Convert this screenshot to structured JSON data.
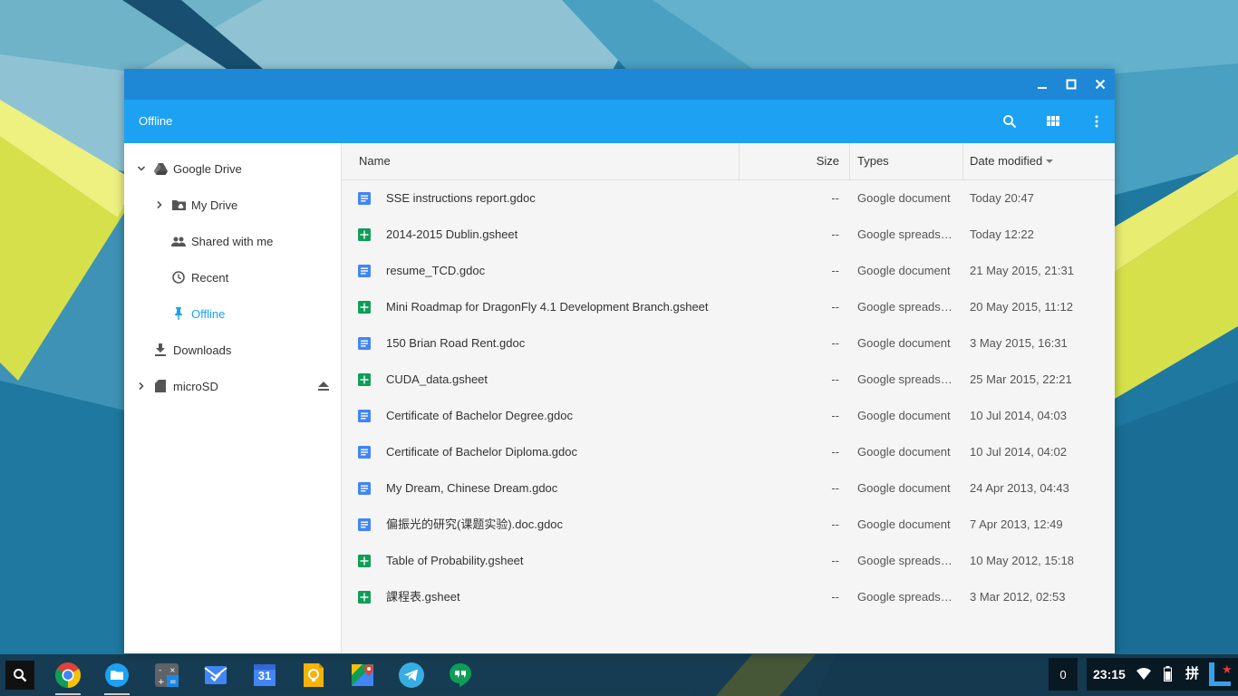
{
  "window": {
    "title": "Offline",
    "controls": {
      "minimize": "minimize-icon",
      "maximize": "maximize-icon",
      "close": "close-icon"
    },
    "toolbar_icons": [
      "search-icon",
      "grid-view-icon",
      "more-vert-icon"
    ]
  },
  "sidebar": {
    "items": [
      {
        "label": "Google Drive",
        "icon": "google-drive-icon",
        "expanded": true
      },
      {
        "label": "My Drive",
        "icon": "folder-drive-icon",
        "expanded": false
      },
      {
        "label": "Shared with me",
        "icon": "people-icon"
      },
      {
        "label": "Recent",
        "icon": "clock-icon"
      },
      {
        "label": "Offline",
        "icon": "pin-icon",
        "active": true
      },
      {
        "label": "Downloads",
        "icon": "download-icon"
      },
      {
        "label": "microSD",
        "icon": "sd-card-icon",
        "expanded": false,
        "eject": "eject-icon"
      }
    ]
  },
  "table": {
    "columns": {
      "name": "Name",
      "size": "Size",
      "type": "Types",
      "date": "Date modified"
    },
    "sort": {
      "column": "date",
      "direction": "descending"
    },
    "rows": [
      {
        "name": "SSE instructions report.gdoc",
        "size": "--",
        "type": "Google document",
        "date": "Today 20:47",
        "kind": "doc"
      },
      {
        "name": "2014-2015 Dublin.gsheet",
        "size": "--",
        "type": "Google spreadsheet",
        "date": "Today 12:22",
        "kind": "sheet"
      },
      {
        "name": "resume_TCD.gdoc",
        "size": "--",
        "type": "Google document",
        "date": "21 May 2015, 21:31",
        "kind": "doc"
      },
      {
        "name": "Mini Roadmap for DragonFly 4.1 Development Branch.gsheet",
        "size": "--",
        "type": "Google spreadsheet",
        "date": "20 May 2015, 11:12",
        "kind": "sheet"
      },
      {
        "name": "150 Brian Road Rent.gdoc",
        "size": "--",
        "type": "Google document",
        "date": "3 May 2015, 16:31",
        "kind": "doc"
      },
      {
        "name": "CUDA_data.gsheet",
        "size": "--",
        "type": "Google spreadsheet",
        "date": "25 Mar 2015, 22:21",
        "kind": "sheet"
      },
      {
        "name": "Certificate of Bachelor Degree.gdoc",
        "size": "--",
        "type": "Google document",
        "date": "10 Jul 2014, 04:03",
        "kind": "doc"
      },
      {
        "name": "Certificate of Bachelor Diploma.gdoc",
        "size": "--",
        "type": "Google document",
        "date": "10 Jul 2014, 04:02",
        "kind": "doc"
      },
      {
        "name": "My Dream, Chinese Dream.gdoc",
        "size": "--",
        "type": "Google document",
        "date": "24 Apr 2013, 04:43",
        "kind": "doc"
      },
      {
        "name": "偏振光的研究(课题实验).doc.gdoc",
        "size": "--",
        "type": "Google document",
        "date": "7 Apr 2013, 12:49",
        "kind": "doc"
      },
      {
        "name": "Table of Probability.gsheet",
        "size": "--",
        "type": "Google spreadsheet",
        "date": "10 May 2012, 15:18",
        "kind": "sheet"
      },
      {
        "name": "課程表.gsheet",
        "size": "--",
        "type": "Google spreadsheet",
        "date": "3 Mar 2012, 02:53",
        "kind": "sheet"
      }
    ]
  },
  "shelf": {
    "apps": [
      "chrome-icon",
      "files-icon",
      "calculator-icon",
      "inbox-icon",
      "calendar-icon",
      "keep-icon",
      "maps-icon",
      "telegram-icon",
      "hangouts-icon"
    ],
    "calendar_day": "31",
    "notification_count": "0",
    "clock": "23:15",
    "ime": "拼"
  },
  "colors": {
    "titlebar": "#1e88d6",
    "toolbar": "#1da1f2",
    "doc_icon": "#4285f4",
    "sheet_icon": "#0f9d58"
  }
}
